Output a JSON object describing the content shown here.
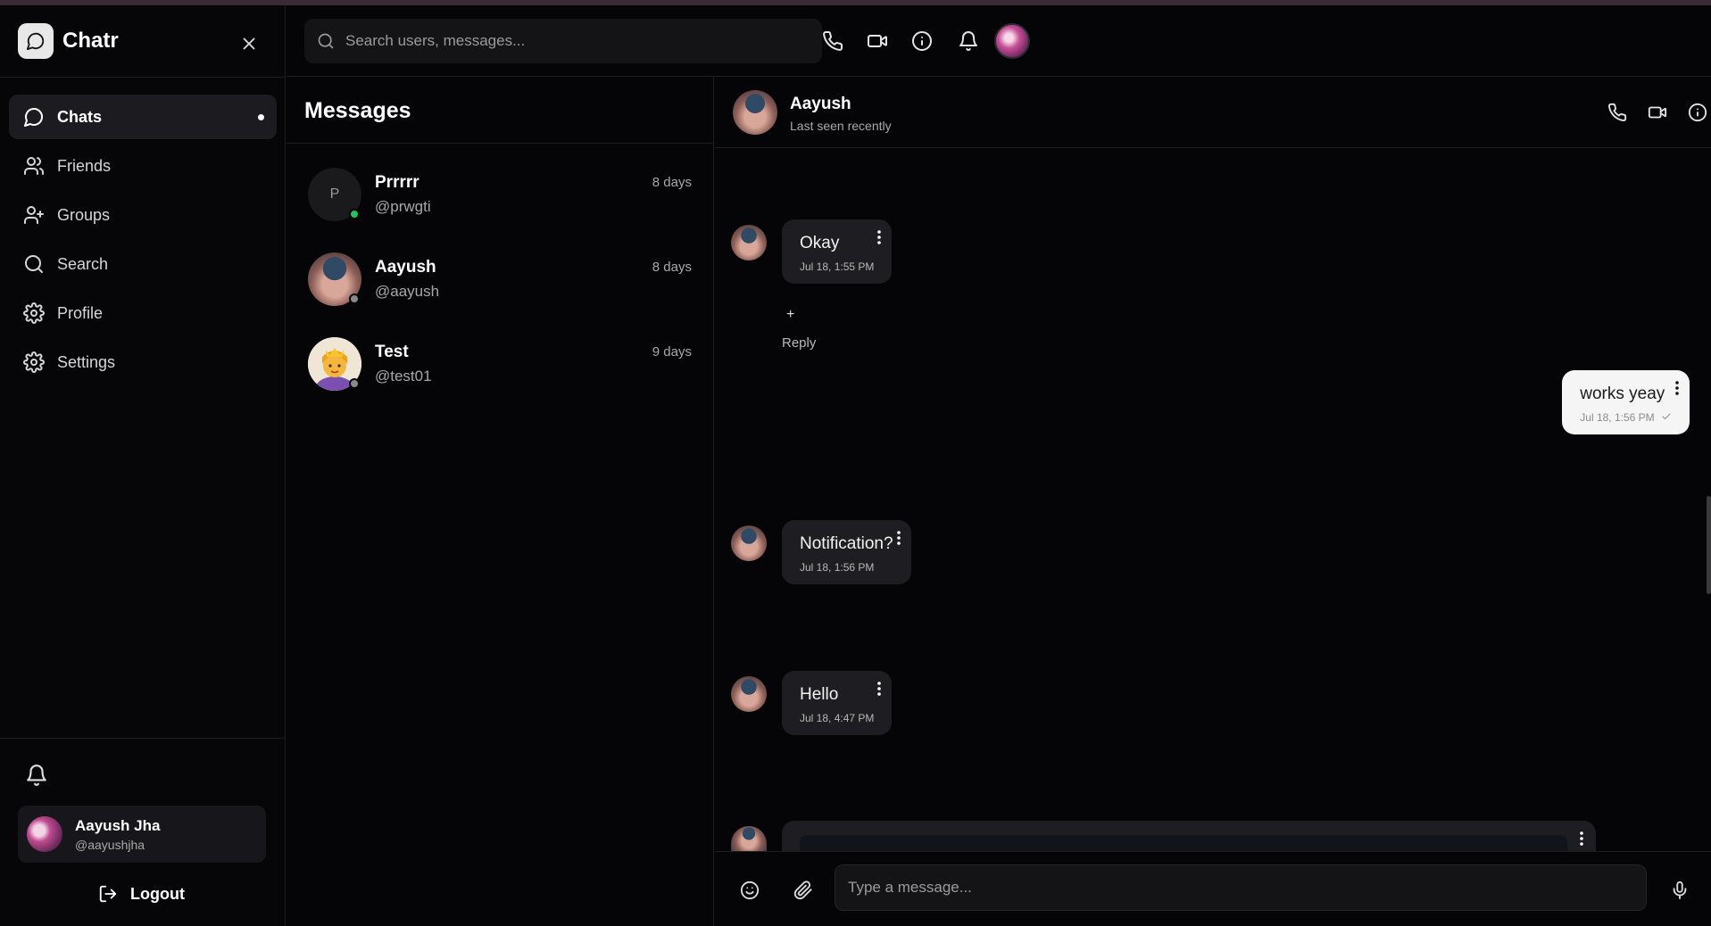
{
  "app": {
    "name": "Chatr"
  },
  "sidebar": {
    "items": [
      {
        "label": "Chats",
        "icon": "chat-bubble-icon"
      },
      {
        "label": "Friends",
        "icon": "users-icon"
      },
      {
        "label": "Groups",
        "icon": "user-plus-icon"
      },
      {
        "label": "Search",
        "icon": "search-icon"
      },
      {
        "label": "Profile",
        "icon": "gear-icon"
      },
      {
        "label": "Settings",
        "icon": "gear-icon"
      }
    ],
    "active": "Chats",
    "user": {
      "name": "Aayush Jha",
      "handle": "@aayushjha"
    },
    "logout_label": "Logout"
  },
  "topbar": {
    "search_placeholder": "Search users, messages..."
  },
  "messages": {
    "title": "Messages",
    "conversations": [
      {
        "name": "Prrrrr",
        "handle": "@prwgti",
        "time": "8 days",
        "avatar_letter": "P",
        "online": true
      },
      {
        "name": "Aayush",
        "handle": "@aayush",
        "time": "8 days",
        "online": false
      },
      {
        "name": "Test",
        "handle": "@test01",
        "time": "9 days",
        "online": false
      }
    ]
  },
  "chat": {
    "name": "Aayush",
    "status": "Last seen recently",
    "messages": [
      {
        "text": "Okay",
        "time": "Jul 18, 1:55 PM",
        "mine": false
      },
      {
        "text": "works yeay",
        "time": "Jul 18, 1:56 PM",
        "mine": true
      },
      {
        "text": "Notification?",
        "time": "Jul 18, 1:56 PM",
        "mine": false
      },
      {
        "text": "Hello",
        "time": "Jul 18, 4:47 PM",
        "mine": false
      }
    ],
    "reaction_add": "+",
    "reply_label": "Reply",
    "composer_placeholder": "Type a message..."
  },
  "colors": {
    "background": "#050507",
    "panel": "#1e1e22",
    "online": "#22c55e",
    "offline": "#8a8a8a",
    "own_bubble": "#f5f5f5"
  }
}
